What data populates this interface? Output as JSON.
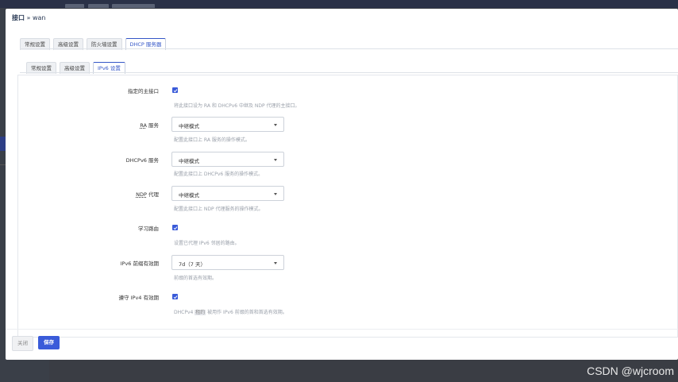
{
  "modal": {
    "title_main": "接口",
    "title_sub": " » wan",
    "main_tabs": [
      "常规设置",
      "高级设置",
      "防火墙设置",
      "DHCP 服务器"
    ],
    "sub_tabs": [
      "常规设置",
      "高级设置",
      "IPv6 设置"
    ],
    "active_main_tab": "DHCP 服务器",
    "active_sub_tab": "IPv6 设置"
  },
  "form": {
    "master": {
      "label": "指定的主接口",
      "checked": true,
      "help": "将此接口设为 RA 和 DHCPv6 中继及 NDP 代理的主接口。"
    },
    "ra": {
      "label_abbr": "RA",
      "label_rest": " 服务",
      "value": "中继模式",
      "help_pre": "配置此接口上 ",
      "help_abbr": "RA",
      "help_post": " 服务的操作模式。"
    },
    "dhcpv6": {
      "label": "DHCPv6 服务",
      "value": "中继模式",
      "help": "配置此接口上 DHCPv6 服务的操作模式。"
    },
    "ndp": {
      "label_abbr": "NDP",
      "label_rest": " 代理",
      "value": "中继模式",
      "help": "配置此接口上 NDP 代理服务的操作模式。"
    },
    "learn_routes": {
      "label": "学习路由",
      "checked": true,
      "help": "设置已代理 IPv6 邻居的路由。"
    },
    "prefix_lifetime": {
      "label": "IPv6 前缀有效期",
      "value": "7d（7 天）",
      "help": "前缀的首选有效期。"
    },
    "follow_ipv4": {
      "label": "遵守 IPv4 有效期",
      "checked": true,
      "help_pre": "DHCPv4 ",
      "help_hl": "租约",
      "help_post": " 被用作 IPv6 前缀的首和首选有效期。"
    }
  },
  "footer": {
    "close_label": "关闭",
    "save_label": "保存"
  },
  "watermark": "CSDN @wjcroom",
  "colors": {
    "accent": "#3a5bd9",
    "backdrop": "#3b3f46"
  }
}
